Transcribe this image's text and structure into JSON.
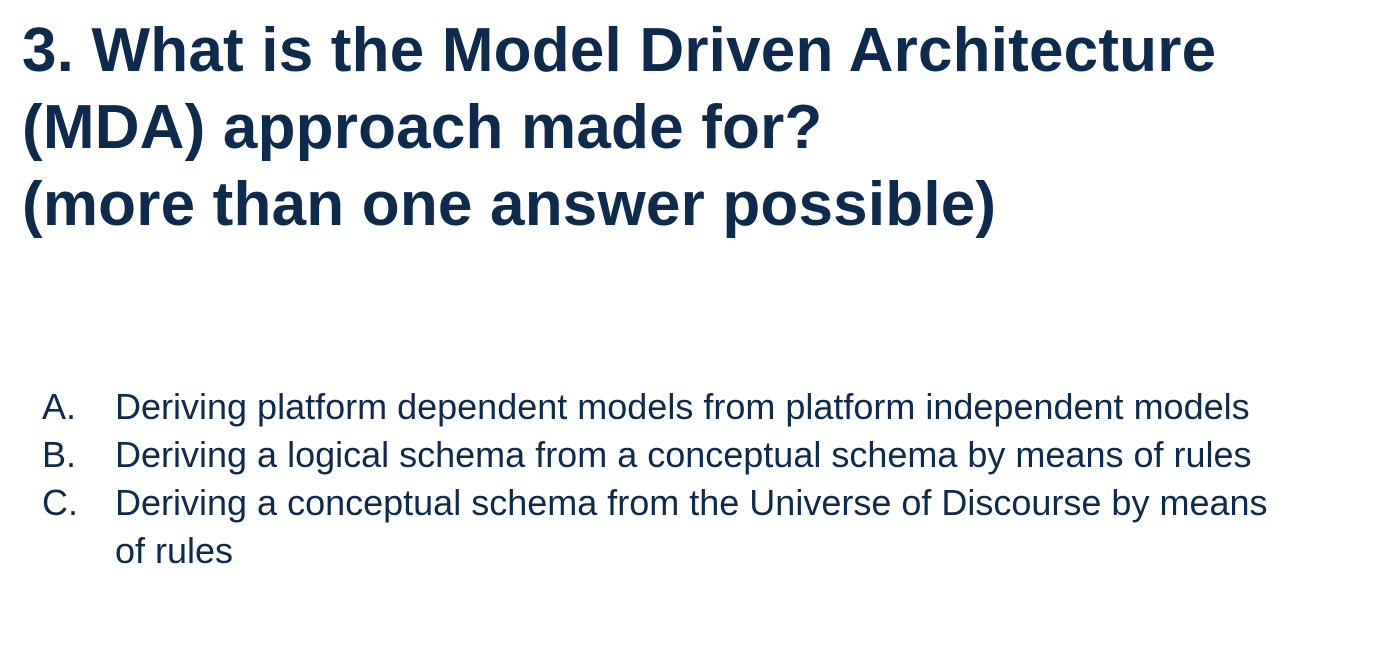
{
  "question": {
    "line1": "3. What is the Model Driven Architecture",
    "line2": "(MDA) approach made for?",
    "line3": "(more than one answer possible)"
  },
  "answers": [
    {
      "letter": "A.",
      "text": "Deriving platform dependent models from platform independent models"
    },
    {
      "letter": "B.",
      "text": "Deriving a logical schema from a conceptual schema by means of rules"
    },
    {
      "letter": "C.",
      "text": "Deriving a conceptual schema from the Universe of Discourse by means of rules"
    }
  ],
  "colors": {
    "text": "#0e2a4d",
    "background": "#ffffff"
  }
}
